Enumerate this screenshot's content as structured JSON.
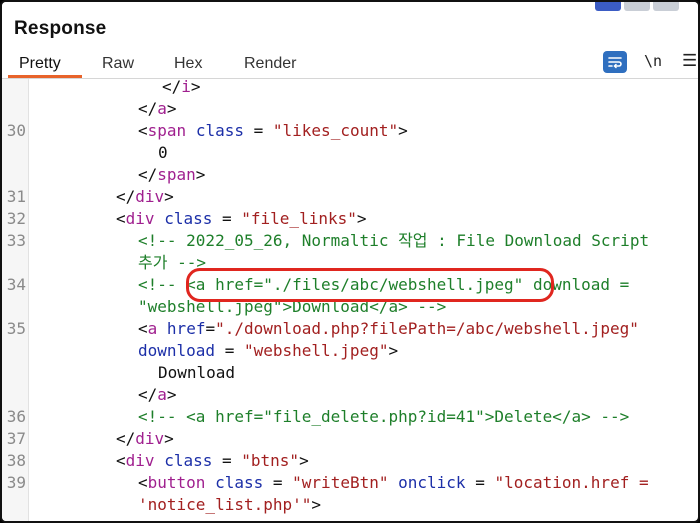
{
  "panel": {
    "title": "Response"
  },
  "tabs": [
    {
      "label": "Pretty",
      "active": true
    },
    {
      "label": "Raw",
      "active": false
    },
    {
      "label": "Hex",
      "active": false
    },
    {
      "label": "Render",
      "active": false
    }
  ],
  "toolbar": {
    "wrap_icon": "text-wrap-icon",
    "newline_label": "\\n",
    "menu_icon": "hamburger-menu-icon",
    "accent_color": "#e8632a"
  },
  "code": {
    "lines": [
      {
        "n": "",
        "segs": [
          [
            "p",
            "</"
          ],
          [
            "t",
            "i"
          ],
          [
            "p",
            ">"
          ]
        ]
      },
      {
        "n": "",
        "segs": [
          [
            "p",
            "</"
          ],
          [
            "t",
            "a"
          ],
          [
            "p",
            ">"
          ]
        ]
      },
      {
        "n": "30",
        "segs": [
          [
            "p",
            "<"
          ],
          [
            "t",
            "span"
          ],
          [
            "p",
            " "
          ],
          [
            "a",
            "class"
          ],
          [
            "p",
            " = "
          ],
          [
            "v",
            "\"likes_count\""
          ],
          [
            "p",
            ">"
          ]
        ]
      },
      {
        "n": "",
        "segs": [
          [
            "p",
            "0"
          ]
        ]
      },
      {
        "n": "",
        "segs": [
          [
            "p",
            "</"
          ],
          [
            "t",
            "span"
          ],
          [
            "p",
            ">"
          ]
        ]
      },
      {
        "n": "31",
        "segs": [
          [
            "p",
            "</"
          ],
          [
            "t",
            "div"
          ],
          [
            "p",
            ">"
          ]
        ]
      },
      {
        "n": "32",
        "segs": [
          [
            "p",
            "<"
          ],
          [
            "t",
            "div"
          ],
          [
            "p",
            " "
          ],
          [
            "a",
            "class"
          ],
          [
            "p",
            " = "
          ],
          [
            "v",
            "\"file_links\""
          ],
          [
            "p",
            ">"
          ]
        ]
      },
      {
        "n": "33",
        "segs": [
          [
            "c",
            "<!-- 2022_05_26, Normaltic 작업 : File Download Script"
          ]
        ]
      },
      {
        "n": "",
        "segs": [
          [
            "c",
            "추가 -->"
          ]
        ]
      },
      {
        "n": "34",
        "segs": [
          [
            "c",
            "<!-- <a href=\"./files/abc/webshell.jpeg\" download ="
          ]
        ]
      },
      {
        "n": "",
        "segs": [
          [
            "c",
            "\"webshell.jpeg\">Download</a> -->"
          ]
        ]
      },
      {
        "n": "35",
        "segs": [
          [
            "p",
            "<"
          ],
          [
            "t",
            "a"
          ],
          [
            "p",
            " "
          ],
          [
            "a",
            "href"
          ],
          [
            "p",
            "="
          ],
          [
            "v",
            "\"./download.php?filePath=/abc/webshell.jpeg\""
          ]
        ]
      },
      {
        "n": "",
        "segs": [
          [
            "a",
            "download"
          ],
          [
            "p",
            " = "
          ],
          [
            "v",
            "\"webshell.jpeg\""
          ],
          [
            "p",
            ">"
          ]
        ]
      },
      {
        "n": "",
        "segs": [
          [
            "p",
            "Download"
          ]
        ]
      },
      {
        "n": "",
        "segs": [
          [
            "p",
            "</"
          ],
          [
            "t",
            "a"
          ],
          [
            "p",
            ">"
          ]
        ]
      },
      {
        "n": "36",
        "segs": [
          [
            "c",
            "<!-- <a href=\"file_delete.php?id=41\">Delete</a> -->"
          ]
        ]
      },
      {
        "n": "37",
        "segs": [
          [
            "p",
            "</"
          ],
          [
            "t",
            "div"
          ],
          [
            "p",
            ">"
          ]
        ]
      },
      {
        "n": "38",
        "segs": [
          [
            "p",
            "<"
          ],
          [
            "t",
            "div"
          ],
          [
            "p",
            " "
          ],
          [
            "a",
            "class"
          ],
          [
            "p",
            " = "
          ],
          [
            "v",
            "\"btns\""
          ],
          [
            "p",
            ">"
          ]
        ]
      },
      {
        "n": "39",
        "segs": [
          [
            "p",
            "<"
          ],
          [
            "t",
            "button"
          ],
          [
            "p",
            " "
          ],
          [
            "a",
            "class"
          ],
          [
            "p",
            " = "
          ],
          [
            "v",
            "\"writeBtn\""
          ],
          [
            "p",
            " "
          ],
          [
            "a",
            "onclick"
          ],
          [
            "p",
            " = "
          ],
          [
            "v",
            "\"location.href ="
          ]
        ]
      },
      {
        "n": "",
        "segs": [
          [
            "v",
            "'notice_list.php'\""
          ],
          [
            "p",
            ">"
          ]
        ]
      }
    ]
  }
}
